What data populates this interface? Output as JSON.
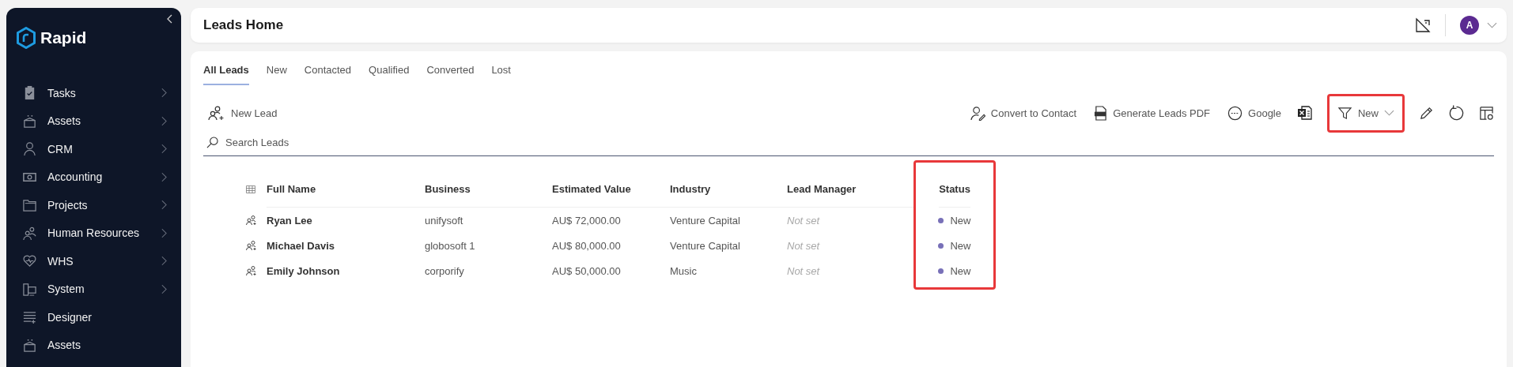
{
  "sidebar": {
    "brand": "Rapid",
    "items": [
      {
        "label": "Tasks",
        "has_submenu": true
      },
      {
        "label": "Assets",
        "has_submenu": true
      },
      {
        "label": "CRM",
        "has_submenu": true
      },
      {
        "label": "Accounting",
        "has_submenu": true
      },
      {
        "label": "Projects",
        "has_submenu": true
      },
      {
        "label": "Human Resources",
        "has_submenu": true
      },
      {
        "label": "WHS",
        "has_submenu": true
      },
      {
        "label": "System",
        "has_submenu": true
      },
      {
        "label": "Designer",
        "has_submenu": false
      },
      {
        "label": "Assets",
        "has_submenu": false
      }
    ]
  },
  "header": {
    "title": "Leads Home",
    "avatar": "A"
  },
  "tabs": [
    {
      "label": "All Leads",
      "selected": true
    },
    {
      "label": "New",
      "selected": false
    },
    {
      "label": "Contacted",
      "selected": false
    },
    {
      "label": "Qualified",
      "selected": false
    },
    {
      "label": "Converted",
      "selected": false
    },
    {
      "label": "Lost",
      "selected": false
    }
  ],
  "toolbar": {
    "new_button": "New Lead",
    "actions": [
      {
        "kind": "convert",
        "label": "Convert to Contact"
      },
      {
        "kind": "pdf",
        "label": "Generate Leads PDF"
      },
      {
        "kind": "google",
        "label": "Google"
      },
      {
        "kind": "excel"
      },
      {
        "kind": "filter",
        "label": "New",
        "highlighted": true
      },
      {
        "kind": "edit"
      },
      {
        "kind": "refresh"
      },
      {
        "kind": "columns"
      }
    ]
  },
  "search": {
    "placeholder": "Search Leads"
  },
  "table": {
    "columns": [
      {
        "label": "Full Name",
        "highlighted": false
      },
      {
        "label": "Business",
        "highlighted": false
      },
      {
        "label": "Estimated Value",
        "highlighted": false
      },
      {
        "label": "Industry",
        "highlighted": false
      },
      {
        "label": "Lead Manager",
        "highlighted": false
      },
      {
        "label": "Status",
        "highlighted": true
      }
    ],
    "rows": [
      {
        "full_name": "Ryan Lee",
        "business": "unifysoft",
        "estimated_value": "AU$ 72,000.00",
        "industry": "Venture Capital",
        "lead_manager": "Not set",
        "manager_assigned": false,
        "status": "New"
      },
      {
        "full_name": "Michael Davis",
        "business": "globosoft 1",
        "estimated_value": "AU$ 80,000.00",
        "industry": "Venture Capital",
        "lead_manager": "Not set",
        "manager_assigned": false,
        "status": "New"
      },
      {
        "full_name": "Emily Johnson",
        "business": "corporify",
        "estimated_value": "AU$ 50,000.00",
        "industry": "Music",
        "lead_manager": "Not set",
        "manager_assigned": false,
        "status": "New"
      }
    ]
  }
}
